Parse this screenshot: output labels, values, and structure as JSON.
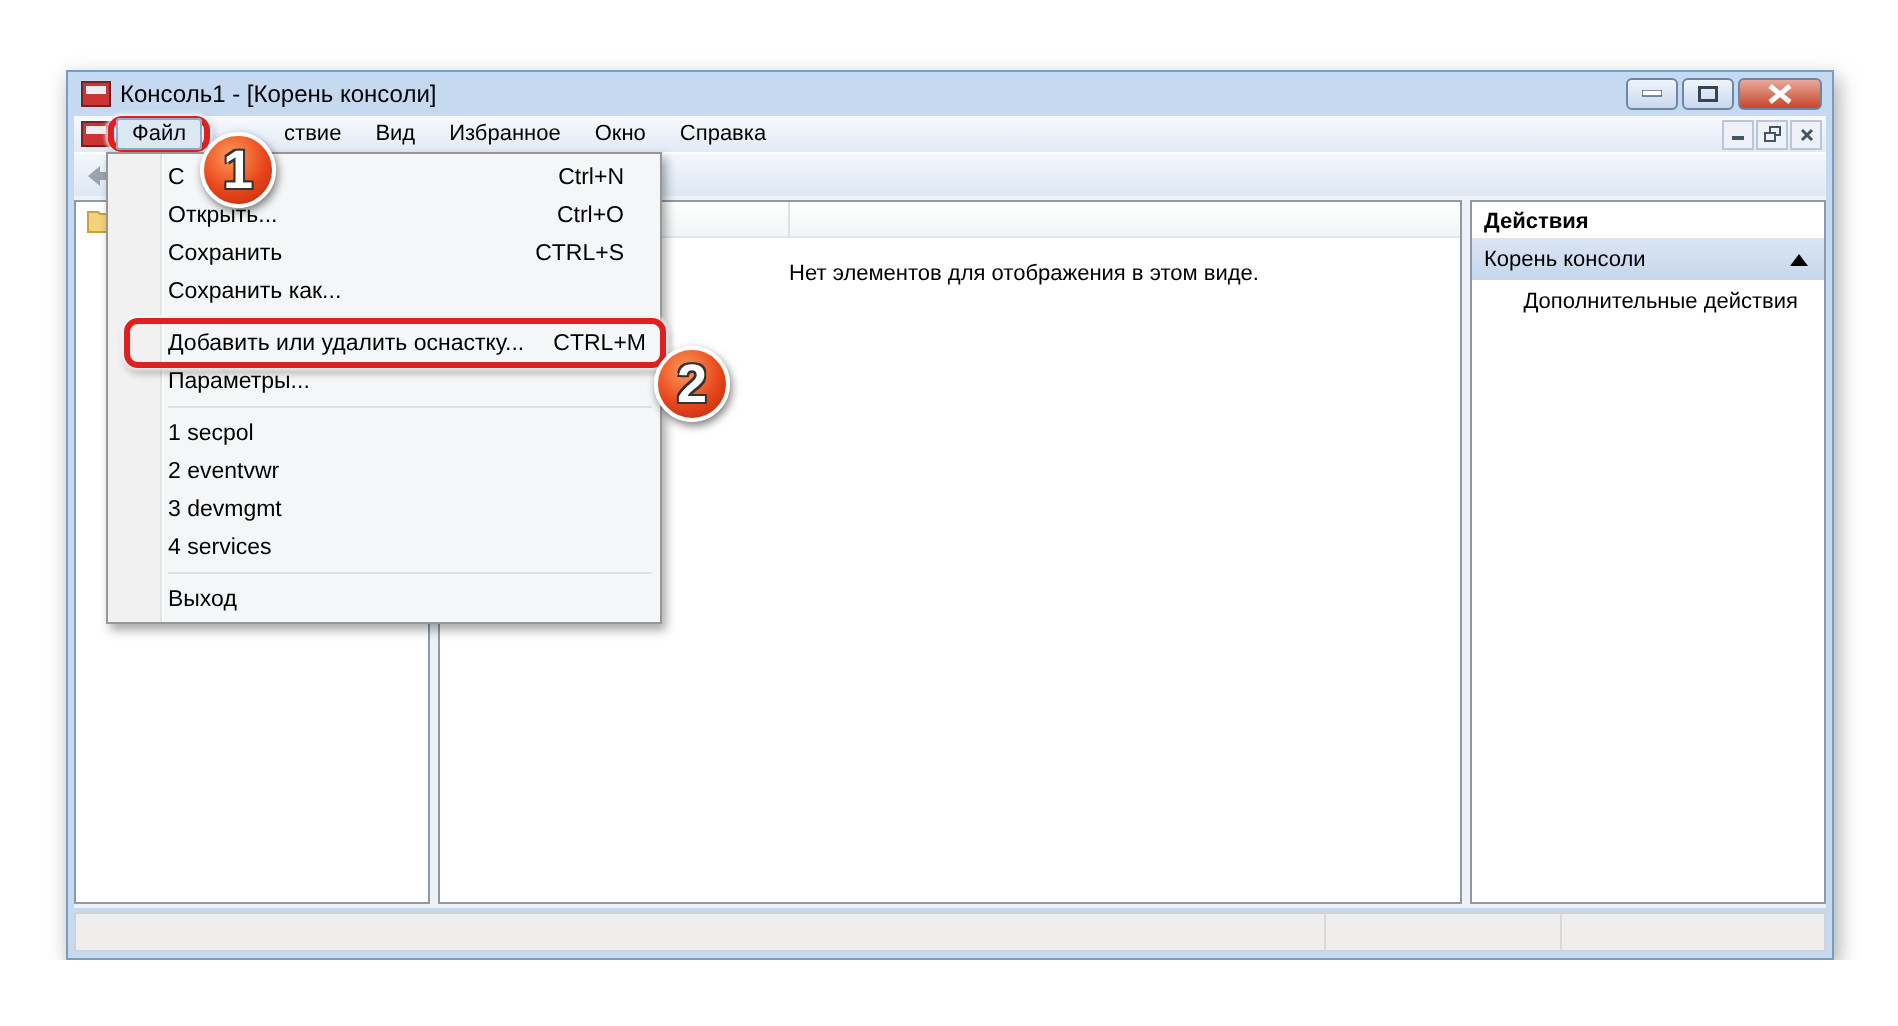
{
  "window": {
    "title": "Консоль1 - [Корень консоли]"
  },
  "menu_bar": [
    {
      "label": "Файл",
      "selected": true,
      "callout": "1"
    },
    {
      "label": "ствие",
      "selected": false
    },
    {
      "label": "Вид",
      "selected": false
    },
    {
      "label": "Избранное",
      "selected": false
    },
    {
      "label": "Окно",
      "selected": false
    },
    {
      "label": "Справка",
      "selected": false
    }
  ],
  "file_menu": [
    {
      "kind": "item",
      "label": "С",
      "shortcut": "Ctrl+N"
    },
    {
      "kind": "item",
      "label": "Открыть...",
      "shortcut": "Ctrl+O"
    },
    {
      "kind": "item",
      "label": "Сохранить",
      "shortcut": "CTRL+S"
    },
    {
      "kind": "item",
      "label": "Сохранить как..."
    },
    {
      "kind": "separator"
    },
    {
      "kind": "item",
      "label": "Добавить или удалить оснастку...",
      "shortcut": "CTRL+M",
      "callout": "2"
    },
    {
      "kind": "item",
      "label": "Параметры..."
    },
    {
      "kind": "separator"
    },
    {
      "kind": "item",
      "label": "1 secpol"
    },
    {
      "kind": "item",
      "label": "2 eventvwr"
    },
    {
      "kind": "item",
      "label": "3 devmgmt"
    },
    {
      "kind": "item",
      "label": "4 services"
    },
    {
      "kind": "separator"
    },
    {
      "kind": "item",
      "label": "Выход"
    }
  ],
  "result_pane": {
    "message": "Нет элементов для отображения в этом виде."
  },
  "actions_pane": {
    "title": "Действия",
    "section": {
      "label": "Корень консоли",
      "expanded": true
    },
    "items": [
      {
        "label": "Дополнительные действия"
      }
    ]
  }
}
